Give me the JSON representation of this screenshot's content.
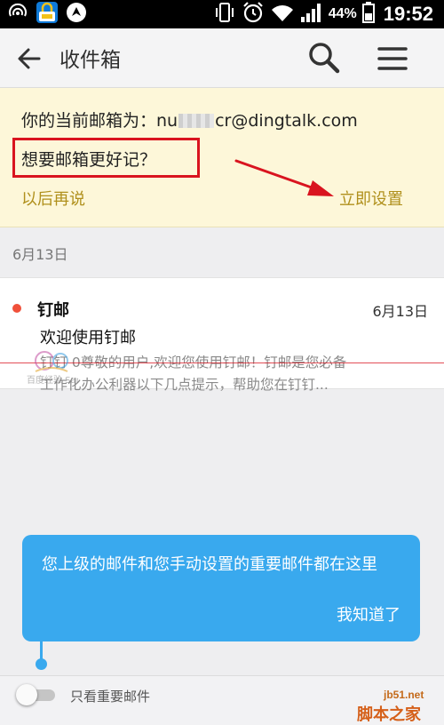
{
  "status_bar": {
    "battery": "44%",
    "time": "19:52"
  },
  "app_bar": {
    "title": "收件箱"
  },
  "banner": {
    "email_line_prefix": "你的当前邮箱为：nu",
    "email_line_suffix": "cr@dingtalk.com",
    "question": "想要邮箱更好记？",
    "later": "以后再说",
    "setup": "立即设置"
  },
  "date_group": "6月13日",
  "mail": {
    "sender": "钉邮",
    "date": "6月13日",
    "subject": "欢迎使用钉邮",
    "preview_line1": "钉钉 0尊敬的用户,欢迎您使用钉邮！钉邮是您必备",
    "preview_line2": "工作化办公利器以下几点提示，帮助您在钉钉..."
  },
  "tooltip": {
    "text": "您上级的邮件和您手动设置的重要邮件都在这里",
    "ok": "我知道了"
  },
  "bottom_bar": {
    "toggle_label": "只看重要邮件",
    "toggle_on": false
  },
  "watermark_logo_text": "百度经验 Sanpitt",
  "watermark": {
    "site": "jb51.net",
    "brand": "脚本之家"
  },
  "colors": {
    "banner_bg": "#fdf7d9",
    "link": "#b0901c",
    "tooltip": "#39a9ee",
    "unread": "#f0503a",
    "annotation": "#d9141f"
  }
}
